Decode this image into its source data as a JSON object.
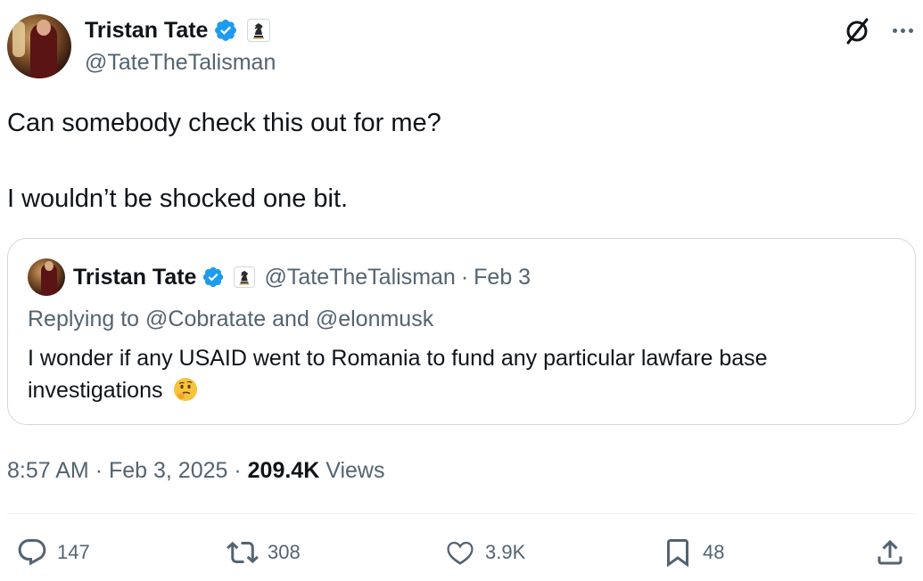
{
  "author": {
    "display_name": "Tristan Tate",
    "handle": "@TateTheTalisman",
    "verified": true,
    "affiliate_icon": "knight-chess-icon"
  },
  "tweet": {
    "line1": "Can somebody check this out for me?",
    "line2": "I wouldn’t be shocked one bit."
  },
  "quote": {
    "display_name": "Tristan Tate",
    "handle": "@TateTheTalisman",
    "separator": "·",
    "date": "Feb 3",
    "replying_to_prefix": "Replying to",
    "replying_to_1": "@Cobratate",
    "replying_to_and": "and",
    "replying_to_2": "@elonmusk",
    "text": "I wonder if any USAID went to Romania to fund any particular lawfare base investigations",
    "emoji": "thinking-face-emoji"
  },
  "meta": {
    "time": "8:57 AM",
    "sep1": "·",
    "date": "Feb 3, 2025",
    "sep2": "·",
    "views_count": "209.4K",
    "views_label": "Views"
  },
  "actions": {
    "replies": "147",
    "retweets": "308",
    "likes": "3.9K",
    "bookmarks": "48"
  },
  "colors": {
    "text": "#0f1419",
    "secondary": "#536471",
    "verified_blue": "#1d9bf0",
    "border": "#cfd9de"
  }
}
